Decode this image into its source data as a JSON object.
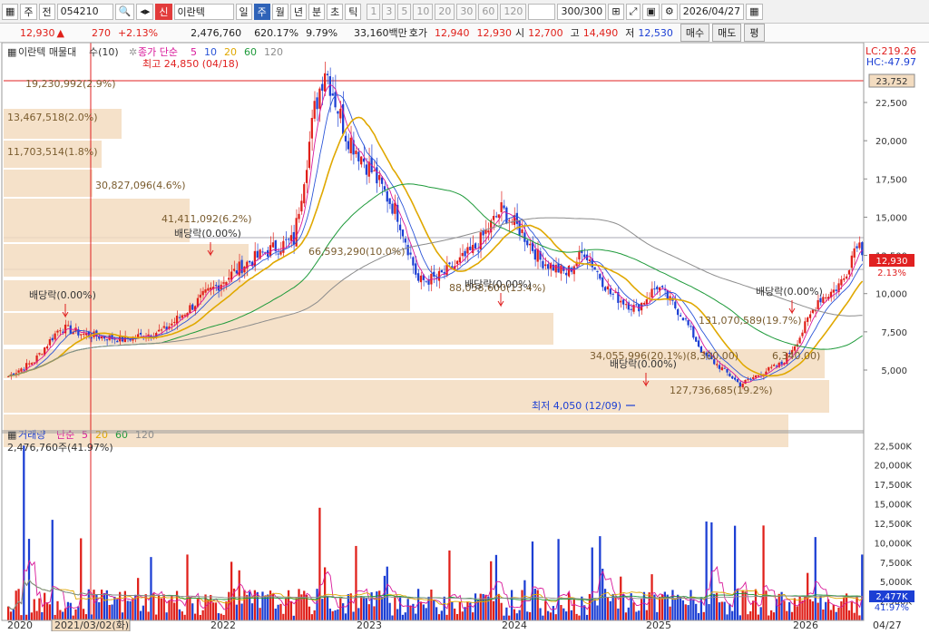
{
  "toolbar": {
    "menu_icon": "grid-icon",
    "period": "주",
    "market": "전",
    "code": "054210",
    "badge": "신",
    "name": "이란텍",
    "timeframes": [
      "일",
      "주",
      "월",
      "년",
      "분",
      "초",
      "틱"
    ],
    "selected_tf": "주",
    "intervals": [
      "1",
      "3",
      "5",
      "10",
      "20",
      "30",
      "60",
      "120"
    ],
    "count": "300",
    "count_total": "/300",
    "date": "2026/04/27"
  },
  "quote": {
    "price": "12,930",
    "arrow": "▲",
    "change": "270",
    "change_pct": "+2.13%",
    "volume": "2,476,760",
    "vol_ratio": "620.17%",
    "turnover": "9.79%",
    "amount": "33,160백만",
    "hoga_label": "호가",
    "ask": "12,940",
    "bid": "12,930",
    "open_label": "시",
    "open": "12,700",
    "high_label": "고",
    "high": "14,490",
    "low_label": "저",
    "low": "12,530",
    "buy": "매수",
    "sell": "매도",
    "avg": "평"
  },
  "price_panel": {
    "title": "이란텍 매물대",
    "title2": "수(10)",
    "ma_label": "종가 단순",
    "ma_periods": [
      "5",
      "10",
      "20",
      "60",
      "120"
    ],
    "lc": "LC:219.26",
    "hc": "HC:-47.97",
    "max_label": "최고 24,850 (04/18)",
    "min_label": "최저 4,050 (12/09)",
    "current": "12,930",
    "current_pct": "2.13%",
    "ref_line": "23,752",
    "y_ticks": [
      "22,500",
      "20,000",
      "17,500",
      "15,000",
      "12,500",
      "10,000",
      "7,500",
      "5,000"
    ],
    "profile_labels": [
      "19,230,992(2.9%)",
      "13,467,518(2.0%)",
      "11,703,514(1.8%)",
      "30,827,096(4.6%)",
      "41,411,092(6.2%)",
      "66,593,290(10.0%)",
      "88,058,600(13.4%)",
      "131,070,589(19.7%)",
      "34,055,996(20.1%)(8,300.00)",
      "6,340.00)",
      "127,736,685(19.2%)"
    ],
    "dividends": [
      "배당락(0.00%)",
      "배당락(0.00%)",
      "배당락(0.00%)",
      "배당락(0.00%)",
      "배당락(0.00%)"
    ]
  },
  "volume_panel": {
    "title": "거래량",
    "ma_label": "단순",
    "ma_periods": [
      "5",
      "20",
      "60",
      "120"
    ],
    "last": "2,476,760주(41.97%)",
    "y_ticks": [
      "22,500K",
      "20,000K",
      "17,500K",
      "15,000K",
      "12,500K",
      "10,000K",
      "7,500K",
      "5,000K",
      "2,500K"
    ],
    "current": "2,477K",
    "current_pct": "41.97%"
  },
  "x_axis": {
    "labels": [
      "2020",
      "2022",
      "2023",
      "2024",
      "2025",
      "2026"
    ],
    "cursor_date": "2021/03/02(화)",
    "end_label": "04/27"
  },
  "colors": {
    "up": "#e0201a",
    "down": "#1c3fd4",
    "ma5": "#d9189a",
    "ma10": "#2b55d8",
    "ma20": "#e0a800",
    "ma60": "#1e9a3a",
    "ma120": "#8c8c8c",
    "profile": "#f3dcc0"
  }
}
